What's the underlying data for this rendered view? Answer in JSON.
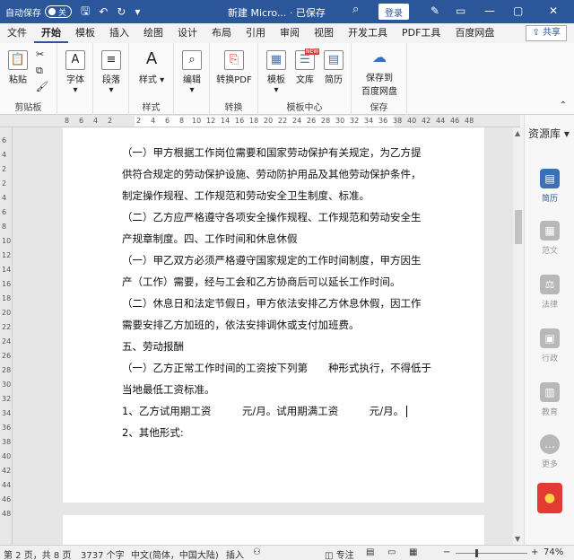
{
  "titlebar": {
    "autosave_label": "自动保存",
    "autosave_state": "关",
    "doc_title": "新建 Micro... · 已保存",
    "login": "登录",
    "min": "—",
    "restore": "▢",
    "close": "✕"
  },
  "tabs": [
    "文件",
    "开始",
    "模板",
    "插入",
    "绘图",
    "设计",
    "布局",
    "引用",
    "审阅",
    "视图",
    "开发工具",
    "PDF工具",
    "百度网盘"
  ],
  "share": "共享",
  "ribbon": {
    "clipboard": {
      "paste": "粘贴",
      "label": "剪贴板"
    },
    "font": "字体",
    "paragraph": "段落",
    "styles": {
      "btn": "样式",
      "label": "样式"
    },
    "editing": "编辑",
    "convert": {
      "btn": "转换PDF",
      "label": "转换"
    },
    "template_center": {
      "template": "模板",
      "wenku": "文库",
      "resume": "简历",
      "label": "模板中心",
      "new_badge": "NEW"
    },
    "save": {
      "btn_line1": "保存到",
      "btn_line2": "百度网盘",
      "label": "保存"
    }
  },
  "ruler": [
    "8",
    "6",
    "4",
    "2",
    "2",
    "4",
    "6",
    "8",
    "10",
    "12",
    "14",
    "16",
    "18",
    "20",
    "22",
    "24",
    "26",
    "28",
    "30",
    "32",
    "34",
    "36",
    "38",
    "40",
    "42",
    "44",
    "46",
    "48"
  ],
  "vruler": [
    "6",
    "4",
    "2",
    "2",
    "4",
    "6",
    "8",
    "10",
    "12",
    "14",
    "16",
    "18",
    "20",
    "22",
    "24",
    "26",
    "28",
    "30",
    "32",
    "34",
    "36",
    "38",
    "40",
    "42",
    "44",
    "46",
    "48"
  ],
  "document": {
    "lines": [
      "（一）甲方根据工作岗位需要和国家劳动保护有关规定，为乙方提",
      "供符合规定的劳动保护设施、劳动防护用品及其他劳动保护条件，",
      "制定操作规程、工作规范和劳动安全卫生制度、标准。",
      "（二）乙方应严格遵守各项安全操作规程、工作规范和劳动安全生",
      "产规章制度。四、工作时间和休息休假",
      "（一）甲乙双方必须严格遵守国家规定的工作时间制度，甲方因生",
      "产（工作）需要，经与工会和乙方协商后可以延长工作时间。",
      "（二）休息日和法定节假日，甲方依法安排乙方休息休假，因工作",
      "需要安排乙方加班的，依法安排调休或支付加班费。",
      "五、劳动报酬",
      "（一）乙方正常工作时间的工资按下列第　　种形式执行，不得低于",
      "当地最低工资标准。",
      "1、乙方试用期工资　　　元/月。试用期满工资　　　元/月。",
      "2、其他形式:"
    ]
  },
  "respane": {
    "title": "资源库",
    "items": [
      "简历",
      "范文",
      "法律",
      "行政",
      "教育",
      "更多"
    ]
  },
  "status": {
    "page": "第 2 页，共 8 页",
    "words": "3737 个字",
    "lang": "中文(简体，中国大陆)",
    "insert": "插入",
    "focus": "专注",
    "zoom": "74%"
  }
}
